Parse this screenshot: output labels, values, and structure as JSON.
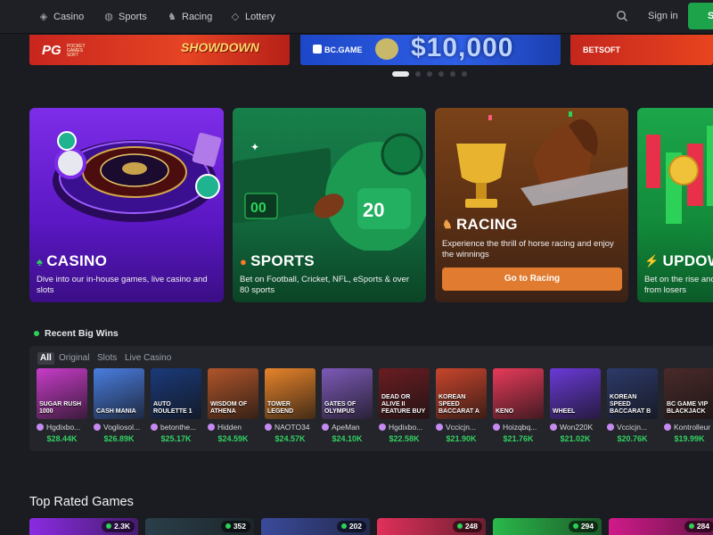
{
  "nav": {
    "items": [
      {
        "label": "Casino",
        "icon": "casino-chip-icon"
      },
      {
        "label": "Sports",
        "icon": "basketball-icon"
      },
      {
        "label": "Racing",
        "icon": "horse-icon"
      },
      {
        "label": "Lottery",
        "icon": "ticket-icon"
      }
    ],
    "signin": "Sign in",
    "signup": "S"
  },
  "banners": {
    "b1_brand": "PG",
    "b1_sub": "POCKET GAMES SOFT",
    "b1_title": "SHOWDOWN",
    "b2_brand": "BC.GAME",
    "b2_amount": "$10,000",
    "b3_brand": "BETSOFT"
  },
  "carousel": {
    "active_index": 0,
    "count": 6
  },
  "cards": {
    "casino": {
      "title": "CASINO",
      "desc": "Dive into our in-house games, live casino and slots"
    },
    "sports": {
      "title": "SPORTS",
      "desc": "Bet on Football, Cricket, NFL, eSports & over 80 sports"
    },
    "racing": {
      "title": "RACING",
      "desc": "Experience the thrill of horse racing and enjoy the winnings",
      "button": "Go to Racing"
    },
    "updown": {
      "title": "UPDOW",
      "desc": "Bet on the rise and profits from losers"
    }
  },
  "recent_wins": {
    "title": "Recent Big Wins",
    "tabs": [
      "All",
      "Original",
      "Slots",
      "Live Casino"
    ],
    "items": [
      {
        "game": "Sugar Rush 1000",
        "user": "Hgdixbo...",
        "amount": "$28.44K",
        "color": "#c83cc9"
      },
      {
        "game": "Cash Mania",
        "user": "Vogliosol...",
        "amount": "$26.89K",
        "color": "#4a7de0"
      },
      {
        "game": "Auto Roulette 1",
        "user": "betonthe...",
        "amount": "$25.17K",
        "color": "#1a3a7a"
      },
      {
        "game": "Wisdom of Athena",
        "user": "Hidden",
        "amount": "$24.59K",
        "color": "#b0552a"
      },
      {
        "game": "Tower Legend",
        "user": "NAOTO34",
        "amount": "$24.57K",
        "color": "#e8842a"
      },
      {
        "game": "Gates of Olympus",
        "user": "ApeMan",
        "amount": "$24.10K",
        "color": "#7d5ab8"
      },
      {
        "game": "Dead or Alive II Feature Buy",
        "user": "Hgdixbo...",
        "amount": "$22.58K",
        "color": "#6a1d22"
      },
      {
        "game": "Korean Speed Baccarat A",
        "user": "Vccicjn...",
        "amount": "$21.90K",
        "color": "#c9452c"
      },
      {
        "game": "Keno",
        "user": "Hoizqbq...",
        "amount": "$21.76K",
        "color": "#e83a5a"
      },
      {
        "game": "Wheel",
        "user": "Won220K",
        "amount": "$21.02K",
        "color": "#6a3ad8"
      },
      {
        "game": "Korean Speed Baccarat B",
        "user": "Vccicjn...",
        "amount": "$20.76K",
        "color": "#2d3a6a"
      },
      {
        "game": "BC Game VIP Blackjack",
        "user": "Kontrolleur",
        "amount": "$19.99K",
        "color": "#4a2a2a"
      }
    ]
  },
  "top_rated": {
    "title": "Top Rated Games",
    "tiles": [
      {
        "count": "2.3K",
        "color": "#8a2be2"
      },
      {
        "count": "352",
        "color": "#2a3f4a"
      },
      {
        "count": "202",
        "color": "#3a4a9a"
      },
      {
        "count": "248",
        "color": "#e0305a"
      },
      {
        "count": "294",
        "color": "#2ab84a"
      },
      {
        "count": "284",
        "color": "#d01a8a"
      }
    ]
  }
}
